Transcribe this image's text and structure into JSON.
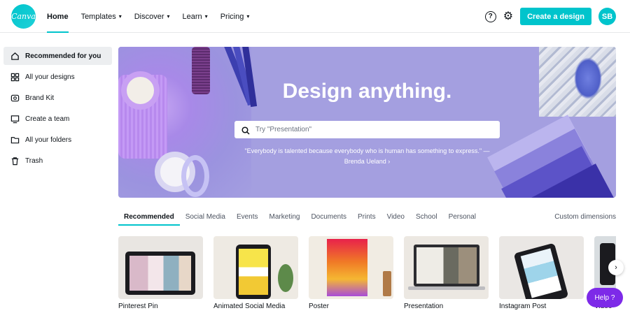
{
  "app": {
    "logo_text": "Canva",
    "accent": "#00c4cc",
    "help_color": "#7d2ae8"
  },
  "nav": {
    "items": [
      {
        "label": "Home",
        "active": true,
        "dropdown": false
      },
      {
        "label": "Templates",
        "active": false,
        "dropdown": true
      },
      {
        "label": "Discover",
        "active": false,
        "dropdown": true
      },
      {
        "label": "Learn",
        "active": false,
        "dropdown": true
      },
      {
        "label": "Pricing",
        "active": false,
        "dropdown": true
      }
    ],
    "help_icon": "?",
    "create_label": "Create a design",
    "avatar_initials": "SB"
  },
  "sidebar": {
    "items": [
      {
        "label": "Recommended for you",
        "icon": "home-icon",
        "active": true
      },
      {
        "label": "All your designs",
        "icon": "grid-icon",
        "active": false
      },
      {
        "label": "Brand Kit",
        "icon": "brand-kit-icon",
        "active": false
      },
      {
        "label": "Create a team",
        "icon": "team-icon",
        "active": false
      },
      {
        "label": "All your folders",
        "icon": "folder-icon",
        "active": false
      },
      {
        "label": "Trash",
        "icon": "trash-icon",
        "active": false
      }
    ]
  },
  "hero": {
    "title": "Design anything.",
    "search_placeholder": "Try \"Presentation\"",
    "quote": "\"Everybody is talented because everybody who is human has something to express.\" —",
    "quote_author": "Brenda Ueland ›",
    "background": "#a49fe0"
  },
  "tabs": {
    "items": [
      "Recommended",
      "Social Media",
      "Events",
      "Marketing",
      "Documents",
      "Prints",
      "Video",
      "School",
      "Personal"
    ],
    "active_index": 0,
    "custom_label": "Custom dimensions"
  },
  "cards": [
    {
      "label": "Pinterest Pin"
    },
    {
      "label": "Animated Social Media"
    },
    {
      "label": "Poster"
    },
    {
      "label": "Presentation"
    },
    {
      "label": "Instagram Post"
    },
    {
      "label": "Video"
    }
  ],
  "floating": {
    "next_icon": "›",
    "help_label": "Help ?"
  }
}
